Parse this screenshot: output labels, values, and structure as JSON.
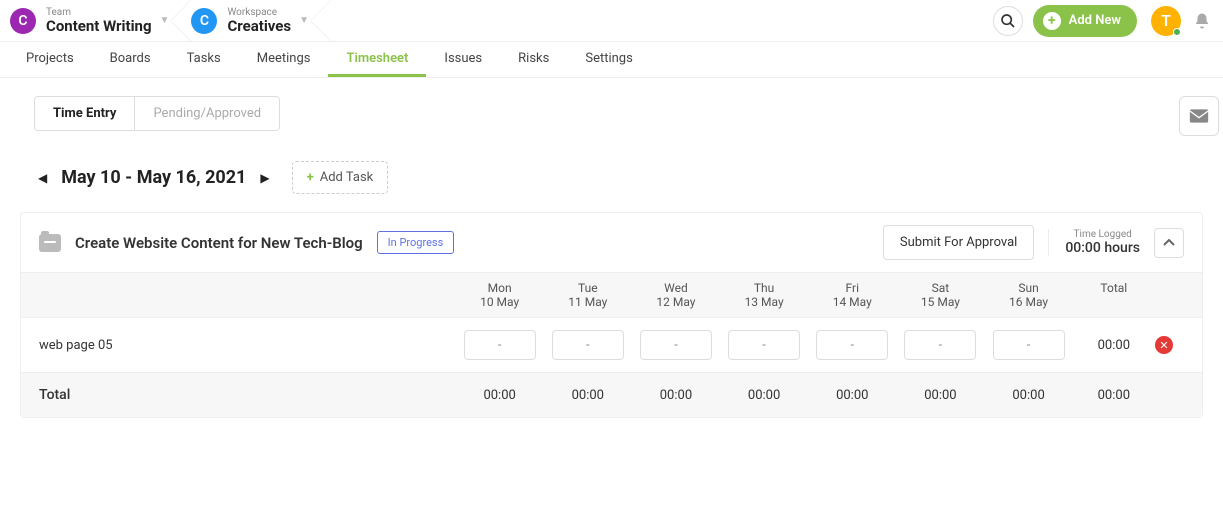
{
  "header": {
    "team_label": "Team",
    "team_name": "Content Writing",
    "team_initial": "C",
    "workspace_label": "Workspace",
    "workspace_name": "Creatives",
    "workspace_initial": "C",
    "add_new_label": "Add New",
    "user_initial": "T"
  },
  "tabs": [
    "Projects",
    "Boards",
    "Tasks",
    "Meetings",
    "Timesheet",
    "Issues",
    "Risks",
    "Settings"
  ],
  "active_tab": "Timesheet",
  "subtabs": {
    "time_entry": "Time Entry",
    "pending": "Pending/Approved"
  },
  "date_range": "May 10 - May 16, 2021",
  "add_task_label": "Add Task",
  "task": {
    "title": "Create Website Content for New Tech-Blog",
    "status": "In Progress",
    "submit_label": "Submit For Approval",
    "time_logged_label": "Time Logged",
    "time_logged_value": "00:00 hours"
  },
  "days": [
    {
      "dow": "Mon",
      "date": "10 May"
    },
    {
      "dow": "Tue",
      "date": "11 May"
    },
    {
      "dow": "Wed",
      "date": "12 May"
    },
    {
      "dow": "Thu",
      "date": "13 May"
    },
    {
      "dow": "Fri",
      "date": "14 May"
    },
    {
      "dow": "Sat",
      "date": "15 May"
    },
    {
      "dow": "Sun",
      "date": "16 May"
    }
  ],
  "total_header": "Total",
  "rows": [
    {
      "name": "web page 05",
      "cells": [
        "-",
        "-",
        "-",
        "-",
        "-",
        "-",
        "-"
      ],
      "total": "00:00"
    }
  ],
  "total_row": {
    "label": "Total",
    "cells": [
      "00:00",
      "00:00",
      "00:00",
      "00:00",
      "00:00",
      "00:00",
      "00:00"
    ],
    "total": "00:00"
  }
}
